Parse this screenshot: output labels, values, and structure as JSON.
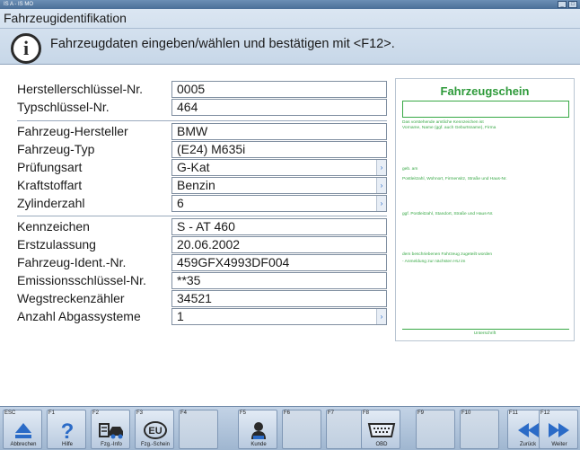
{
  "window": {
    "title": "IS A - IS MO"
  },
  "header": {
    "title": "Fahrzeugidentifikation",
    "message": "Fahrzeugdaten eingeben/wählen und bestätigen mit <F12>."
  },
  "form": {
    "rows": [
      {
        "label": "Herstellerschlüssel-Nr.",
        "value": "0005",
        "dropdown": false
      },
      {
        "label": "Typschlüssel-Nr.",
        "value": "464",
        "dropdown": false
      },
      {
        "label": "Fahrzeug-Hersteller",
        "value": "BMW",
        "dropdown": false
      },
      {
        "label": "Fahrzeug-Typ",
        "value": "(E24) M635i",
        "dropdown": false
      },
      {
        "label": "Prüfungsart",
        "value": "G-Kat",
        "dropdown": true
      },
      {
        "label": "Kraftstoffart",
        "value": "Benzin",
        "dropdown": true
      },
      {
        "label": "Zylinderzahl",
        "value": "6",
        "dropdown": true
      },
      {
        "label": "Kennzeichen",
        "value": "S - AT 460",
        "dropdown": false
      },
      {
        "label": "Erstzulassung",
        "value": "20.06.2002",
        "dropdown": false
      },
      {
        "label": "Fahrzeug-Ident.-Nr.",
        "value": "459GFX4993DF004",
        "dropdown": false
      },
      {
        "label": "Emissionsschlüssel-Nr.",
        "value": "**35",
        "dropdown": false
      },
      {
        "label": "Wegstreckenzähler",
        "value": "34521",
        "dropdown": false
      },
      {
        "label": "Anzahl Abgassysteme",
        "value": "1",
        "dropdown": true
      }
    ],
    "dropdown_arrow": "›"
  },
  "schein": {
    "title": "Fahrzeugschein",
    "lines": [
      "Das vorstehende amtliche Kennzeichen ist",
      "Vorname, Name (ggf. auch Geburtsname), Firma",
      "geb. am",
      "Postleitzahl, Wohnort, Firmensitz, Straße und Haus-Nr.",
      "ggf. Postleitzahl, Standort, Straße und Haus-Nr.",
      "dem beschriebenen Fahrzeug zugeteilt worden",
      "- Anmeldung zur nächsten HU im"
    ],
    "signature": "Unterschrift"
  },
  "fkeys": [
    {
      "key": "ESC",
      "label": "Abbrechen",
      "icon": "eject-icon",
      "enabled": true
    },
    {
      "key": "F1",
      "label": "Hilfe",
      "icon": "help-icon",
      "enabled": true
    },
    {
      "key": "F2",
      "label": "Fzg.-Info",
      "icon": "car-info-icon",
      "enabled": true
    },
    {
      "key": "F3",
      "label": "Fzg.-Schein",
      "icon": "eu-icon",
      "icon_text": "EU",
      "enabled": true
    },
    {
      "key": "F4",
      "label": "",
      "icon": "",
      "enabled": false
    },
    {
      "key": "F5",
      "label": "Kunde",
      "icon": "customer-icon",
      "enabled": true
    },
    {
      "key": "F6",
      "label": "",
      "icon": "",
      "enabled": false
    },
    {
      "key": "F7",
      "label": "",
      "icon": "",
      "enabled": false
    },
    {
      "key": "F8",
      "label": "OBD",
      "icon": "obd-connector-icon",
      "enabled": true
    },
    {
      "key": "F9",
      "label": "",
      "icon": "",
      "enabled": false
    },
    {
      "key": "F10",
      "label": "",
      "icon": "",
      "enabled": false
    },
    {
      "key": "F11",
      "label": "Zurück",
      "icon": "back-arrow-icon",
      "enabled": true
    },
    {
      "key": "F12",
      "label": "Weiter",
      "icon": "forward-arrow-icon",
      "enabled": true
    }
  ],
  "colors": {
    "accent_blue": "#2b6bc7",
    "schein_green": "#37a845"
  }
}
